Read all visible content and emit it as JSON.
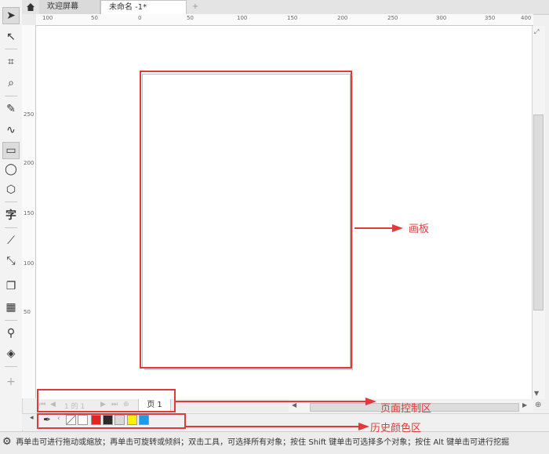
{
  "tabs": {
    "home_icon": "home-icon",
    "welcome": "欢迎屏幕",
    "document": "未命名 -1*",
    "add": "+"
  },
  "ruler": {
    "top_ticks": [
      "100",
      "50",
      "0",
      "50",
      "100",
      "150",
      "200",
      "250",
      "300",
      "350",
      "400"
    ],
    "left_ticks": [
      "250",
      "200",
      "150",
      "100",
      "50"
    ]
  },
  "page_control": {
    "page_count": "1 的 1",
    "page_tab": "页 1"
  },
  "palette": {
    "swatches": [
      "#ffffff",
      "#e52421",
      "#2b2b2b",
      "#d9d9d9",
      "#fff200",
      "#1e9be8"
    ]
  },
  "annotations": {
    "artboard": "画板",
    "page_control": "页面控制区",
    "history_colors": "历史颜色区"
  },
  "status": {
    "text": "再单击可进行拖动或缩放；再单击可旋转或倾斜；双击工具，可选择所有对象；按住 Shift 键单击可选择多个对象；按住 Alt 键单击可进行挖掘"
  }
}
